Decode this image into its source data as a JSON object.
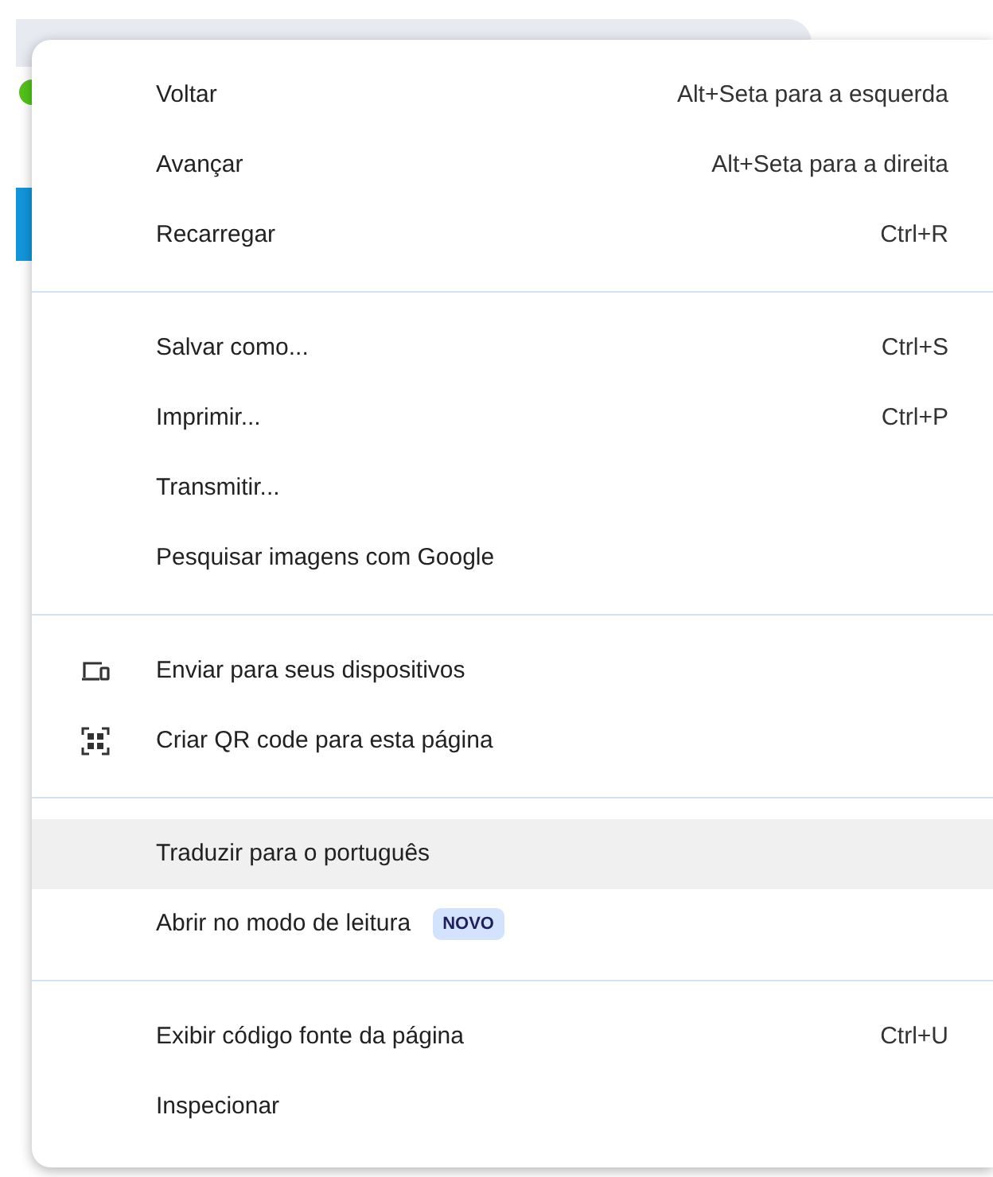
{
  "context_menu": {
    "sections": [
      {
        "items": [
          {
            "label": "Voltar",
            "shortcut": "Alt+Seta para a esquerda",
            "selected": false
          },
          {
            "label": "Avançar",
            "shortcut": "Alt+Seta para a direita",
            "selected": false
          },
          {
            "label": "Recarregar",
            "shortcut": "Ctrl+R",
            "selected": false
          }
        ]
      },
      {
        "items": [
          {
            "label": "Salvar como...",
            "shortcut": "Ctrl+S",
            "selected": false
          },
          {
            "label": "Imprimir...",
            "shortcut": "Ctrl+P",
            "selected": false
          },
          {
            "label": "Transmitir...",
            "selected": false
          },
          {
            "label": "Pesquisar imagens com Google",
            "selected": false
          }
        ]
      },
      {
        "items": [
          {
            "label": "Enviar para seus dispositivos",
            "kind": "devices",
            "selected": false
          },
          {
            "label": "Criar QR code para esta página",
            "kind": "qr",
            "selected": false
          }
        ]
      },
      {
        "items": [
          {
            "label": "Traduzir para o português",
            "selected": true
          },
          {
            "label": "Abrir no modo de leitura",
            "badge": "NOVO",
            "selected": false
          }
        ]
      },
      {
        "items": [
          {
            "label": "Exibir código fonte da página",
            "shortcut": "Ctrl+U",
            "selected": false
          },
          {
            "label": "Inspecionar",
            "selected": false
          }
        ]
      }
    ]
  }
}
